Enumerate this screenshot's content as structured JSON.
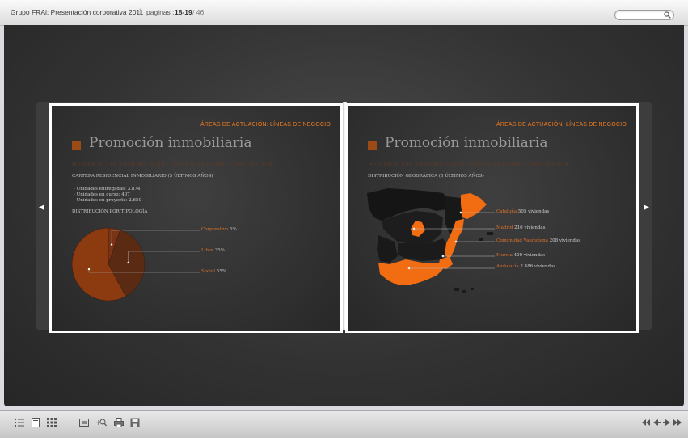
{
  "toolbar": {
    "title": "Grupo FRAi: Presentación corporativa 2011",
    "separator": "|",
    "pages_label": "paginas :",
    "current_pages": "18-19",
    "total_pages": "/ 46",
    "search_placeholder": ""
  },
  "left_page": {
    "header": "ÁREAS DE ACTUACIÓN: LÍNEAS DE NEGOCIO",
    "title": "Promoción inmobiliaria",
    "subtitle": "RESIDENCIAL INMOBILIARIO: VIVIENDA LIBRE Y PROTEGIDA",
    "portfolio_label": "CARTERA RESIDENCIAL INMOBILIARIO (5 últimos años)",
    "portfolio_lines": [
      "- Unidades entregadas: 3.874",
      "- Unidades en curso: 407",
      "- Unidades en proyecto: 2.650"
    ],
    "distribution_label": "DISTRIBUCIÓN POR TIPOLOGÍA"
  },
  "chart_data": {
    "type": "pie",
    "title": "DISTRIBUCIÓN POR TIPOLOGÍA",
    "slices": [
      {
        "name": "Corporativo",
        "value": 5
      },
      {
        "name": "Libre",
        "value": 35
      },
      {
        "name": "Social",
        "value": 55
      }
    ],
    "labels": [
      {
        "name": "Corporativo",
        "value_text": "5%"
      },
      {
        "name": "Libre",
        "value_text": "35%"
      },
      {
        "name": "Social",
        "value_text": "55%"
      }
    ]
  },
  "right_page": {
    "header": "ÁREAS DE ACTUACIÓN: LÍNEAS DE NEGOCIO",
    "title": "Promoción inmobiliaria",
    "subtitle": "RESIDENCIAL INMOBILIARIO: VIVIENDA LIBRE Y PROTEGIDA",
    "geo_label": "DISTRIBUCIÓN GEOGRÁFICA (5 últimos años)",
    "regions": [
      {
        "name": "Cataluña",
        "value": "505 viviendas"
      },
      {
        "name": "Madrid",
        "value": "216 viviendas"
      },
      {
        "name": "Comunidad Valenciana",
        "value": "208 viviendas"
      },
      {
        "name": "Murcia",
        "value": "400 viviendas"
      },
      {
        "name": "Andalucía",
        "value": "2.486 viviendas"
      }
    ]
  },
  "colors": {
    "accent": "#f07b1c",
    "page_bg": "#333333",
    "stage_bg": "#2e2e2e"
  },
  "bottom_toolbar": {
    "icons": [
      "list-icon",
      "page-icon",
      "grid-icon",
      "fullscreen-icon",
      "zoom-in-icon",
      "print-icon",
      "save-icon"
    ],
    "nav_icons": [
      "first-page-icon",
      "previous-page-icon",
      "next-page-icon",
      "last-page-icon"
    ]
  }
}
